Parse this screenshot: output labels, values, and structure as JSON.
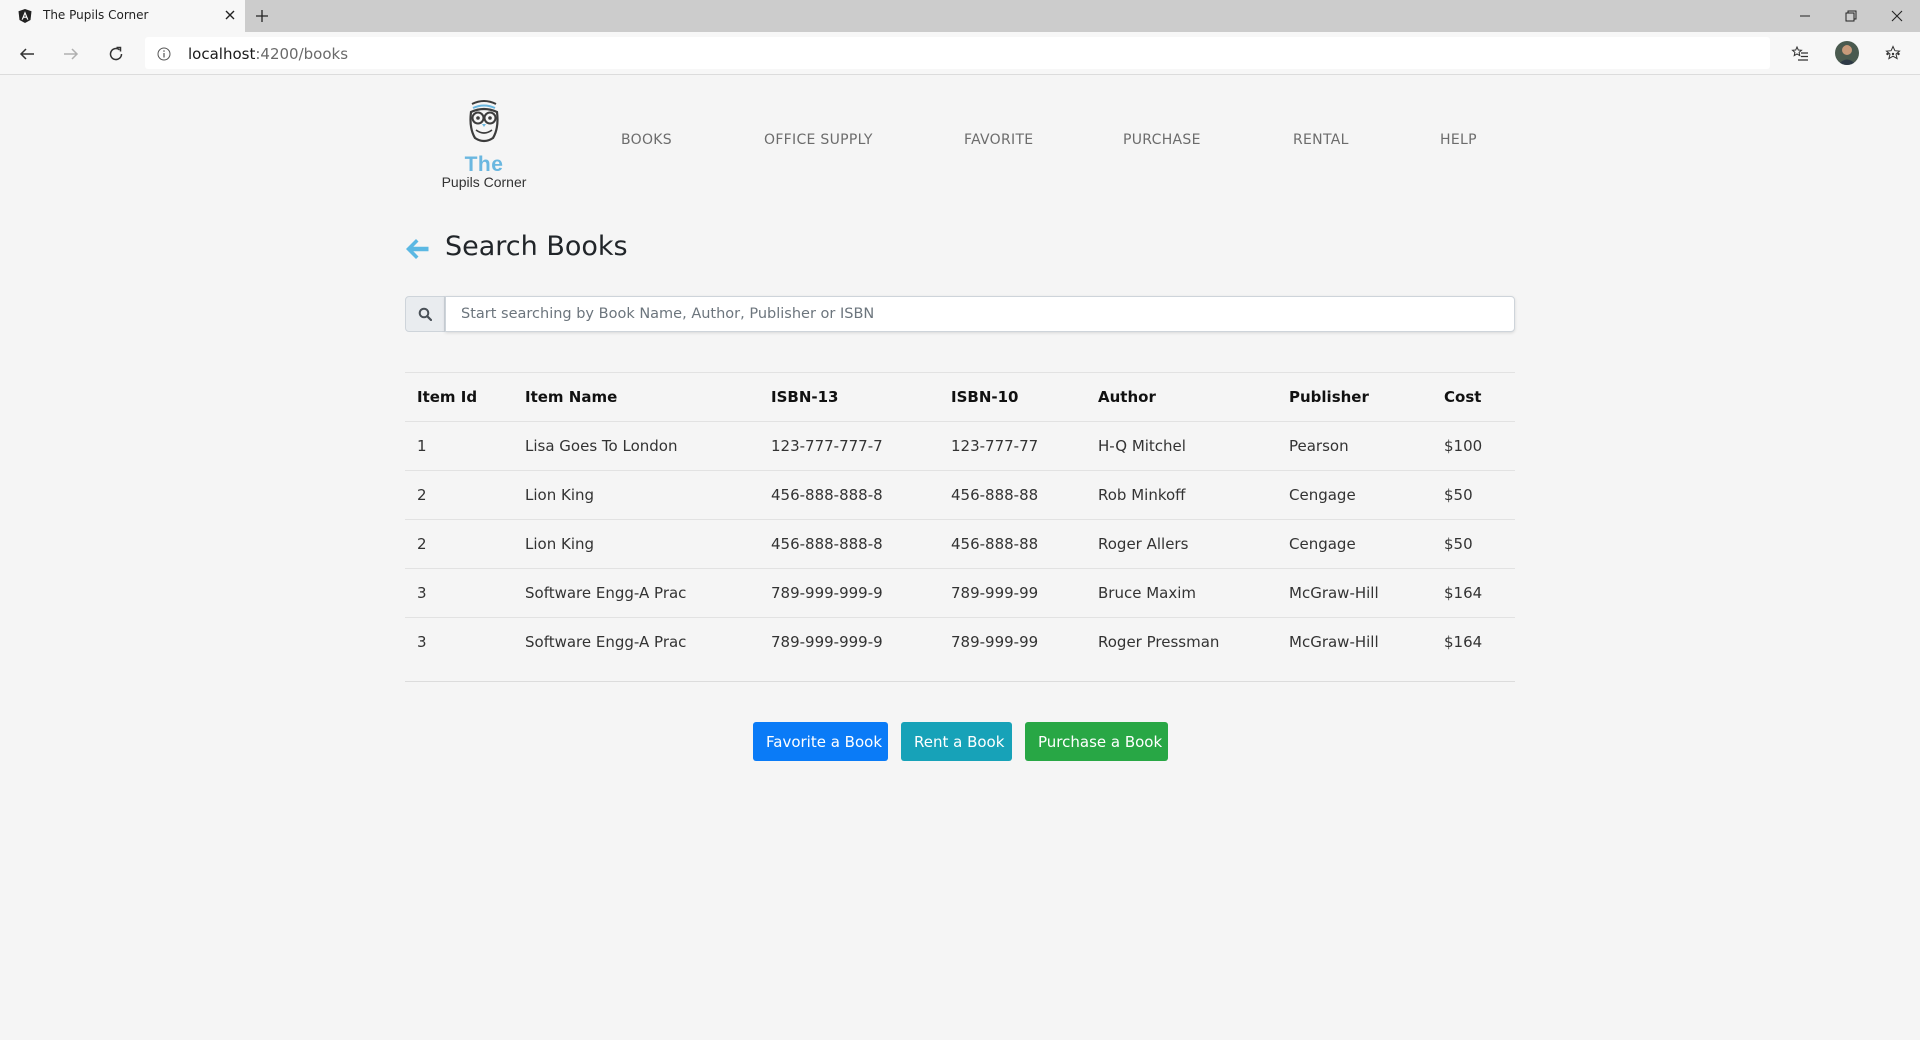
{
  "browser": {
    "tab_title": "The Pupils Corner",
    "url_host": "localhost",
    "url_path": ":4200/books"
  },
  "brand": {
    "logo_the": "The",
    "logo_sub": "Pupils Corner",
    "accent": "#6ab7e0"
  },
  "nav": {
    "items": [
      {
        "label": "BOOKS"
      },
      {
        "label": "OFFICE SUPPLY"
      },
      {
        "label": "FAVORITE"
      },
      {
        "label": "PURCHASE"
      },
      {
        "label": "RENTAL"
      },
      {
        "label": "HELP"
      }
    ]
  },
  "page": {
    "title": "Search Books"
  },
  "search": {
    "placeholder": "Start searching by Book Name, Author, Publisher or ISBN",
    "value": ""
  },
  "table": {
    "columns": [
      "Item Id",
      "Item Name",
      "ISBN-13",
      "ISBN-10",
      "Author",
      "Publisher",
      "Cost"
    ],
    "rows": [
      [
        "1",
        "Lisa Goes To London",
        "123-777-777-7",
        "123-777-77",
        "H-Q Mitchel",
        "Pearson",
        "$100"
      ],
      [
        "2",
        "Lion King",
        "456-888-888-8",
        "456-888-88",
        "Rob Minkoff",
        "Cengage",
        "$50"
      ],
      [
        "2",
        "Lion King",
        "456-888-888-8",
        "456-888-88",
        "Roger Allers",
        "Cengage",
        "$50"
      ],
      [
        "3",
        "Software Engg-A Prac",
        "789-999-999-9",
        "789-999-99",
        "Bruce Maxim",
        "McGraw-Hill",
        "$164"
      ],
      [
        "3",
        "Software Engg-A Prac",
        "789-999-999-9",
        "789-999-99",
        "Roger Pressman",
        "McGraw-Hill",
        "$164"
      ]
    ]
  },
  "actions": {
    "favorite": "Favorite a Book",
    "rent": "Rent a Book",
    "purchase": "Purchase a Book",
    "colors": {
      "favorite": "#0a7bf7",
      "rent": "#17a2b8",
      "purchase": "#28a745"
    }
  }
}
